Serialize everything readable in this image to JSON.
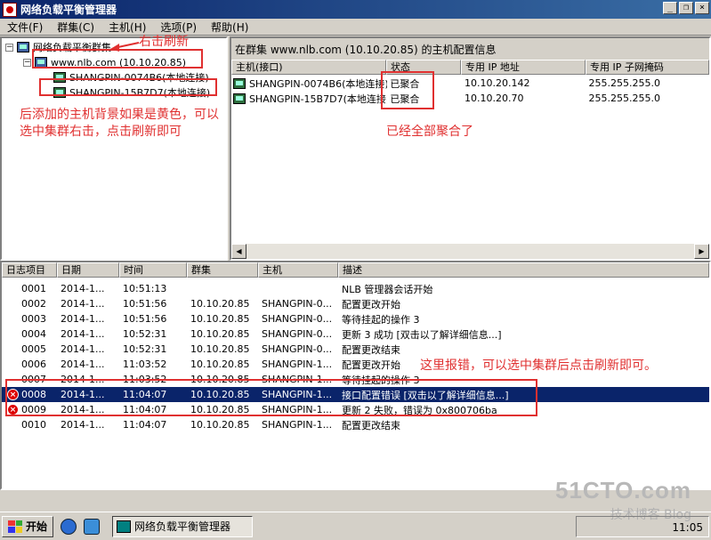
{
  "window": {
    "title": "网络负载平衡管理器",
    "buttons": [
      "_",
      "❐",
      "×"
    ]
  },
  "menu": [
    "文件(F)",
    "群集(C)",
    "主机(H)",
    "选项(P)",
    "帮助(H)"
  ],
  "tree": {
    "root": "网络负载平衡群集",
    "cluster": "www.nlb.com (10.10.20.85)",
    "hosts": [
      "SHANGPIN-0074B6(本地连接)",
      "SHANGPIN-15B7D7(本地连接)"
    ]
  },
  "right": {
    "header": "在群集 www.nlb.com (10.10.20.85) 的主机配置信息",
    "columns": [
      "主机(接口)",
      "状态",
      "专用 IP 地址",
      "专用 IP 子网掩码"
    ],
    "rows": [
      {
        "host": "SHANGPIN-0074B6(本地连接)",
        "status": "已聚合",
        "ip": "10.10.20.142",
        "mask": "255.255.255.0"
      },
      {
        "host": "SHANGPIN-15B7D7(本地连接)",
        "status": "已聚合",
        "ip": "10.10.20.70",
        "mask": "255.255.255.0"
      }
    ]
  },
  "log": {
    "columns": [
      "日志项目",
      "日期",
      "时间",
      "群集",
      "主机",
      "描述"
    ],
    "rows": [
      {
        "id": "0001",
        "date": "2014-1...",
        "time": "10:51:13",
        "cluster": "",
        "host": "",
        "desc": "NLB 管理器会话开始",
        "error": false
      },
      {
        "id": "0002",
        "date": "2014-1...",
        "time": "10:51:56",
        "cluster": "10.10.20.85",
        "host": "SHANGPIN-0...",
        "desc": "配置更改开始",
        "error": false
      },
      {
        "id": "0003",
        "date": "2014-1...",
        "time": "10:51:56",
        "cluster": "10.10.20.85",
        "host": "SHANGPIN-0...",
        "desc": "等待挂起的操作 3",
        "error": false
      },
      {
        "id": "0004",
        "date": "2014-1...",
        "time": "10:52:31",
        "cluster": "10.10.20.85",
        "host": "SHANGPIN-0...",
        "desc": "更新 3 成功 [双击以了解详细信息...]",
        "error": false
      },
      {
        "id": "0005",
        "date": "2014-1...",
        "time": "10:52:31",
        "cluster": "10.10.20.85",
        "host": "SHANGPIN-0...",
        "desc": "配置更改结束",
        "error": false
      },
      {
        "id": "0006",
        "date": "2014-1...",
        "time": "11:03:52",
        "cluster": "10.10.20.85",
        "host": "SHANGPIN-1...",
        "desc": "配置更改开始",
        "error": false
      },
      {
        "id": "0007",
        "date": "2014-1...",
        "time": "11:03:52",
        "cluster": "10.10.20.85",
        "host": "SHANGPIN-1...",
        "desc": "等待挂起的操作 3",
        "error": false
      },
      {
        "id": "0008",
        "date": "2014-1...",
        "time": "11:04:07",
        "cluster": "10.10.20.85",
        "host": "SHANGPIN-1...",
        "desc": "接口配置错误 [双击以了解详细信息...]",
        "error": true
      },
      {
        "id": "0009",
        "date": "2014-1...",
        "time": "11:04:07",
        "cluster": "10.10.20.85",
        "host": "SHANGPIN-1...",
        "desc": "更新 2 失败，错误为 0x800706ba",
        "error": true
      },
      {
        "id": "0010",
        "date": "2014-1...",
        "time": "11:04:07",
        "cluster": "10.10.20.85",
        "host": "SHANGPIN-1...",
        "desc": "配置更改结束",
        "error": false
      }
    ]
  },
  "annotations": {
    "refresh": "右击刷新",
    "yellow_line1": "后添加的主机背景如果是黄色，可以",
    "yellow_line2": "选中集群右击，点击刷新即可",
    "converged": "已经全部聚合了",
    "error_note": "这里报错，可以选中集群后点击刷新即可。"
  },
  "taskbar": {
    "start": "开始",
    "task": "网络负载平衡管理器",
    "clock": "11:05"
  },
  "watermark": {
    "main": "51CTO.com",
    "sub": "技术博客  Blog"
  },
  "colors": {
    "annotation": "#e03030",
    "titlebar": "#0a246a",
    "selection": "#0a246a"
  }
}
